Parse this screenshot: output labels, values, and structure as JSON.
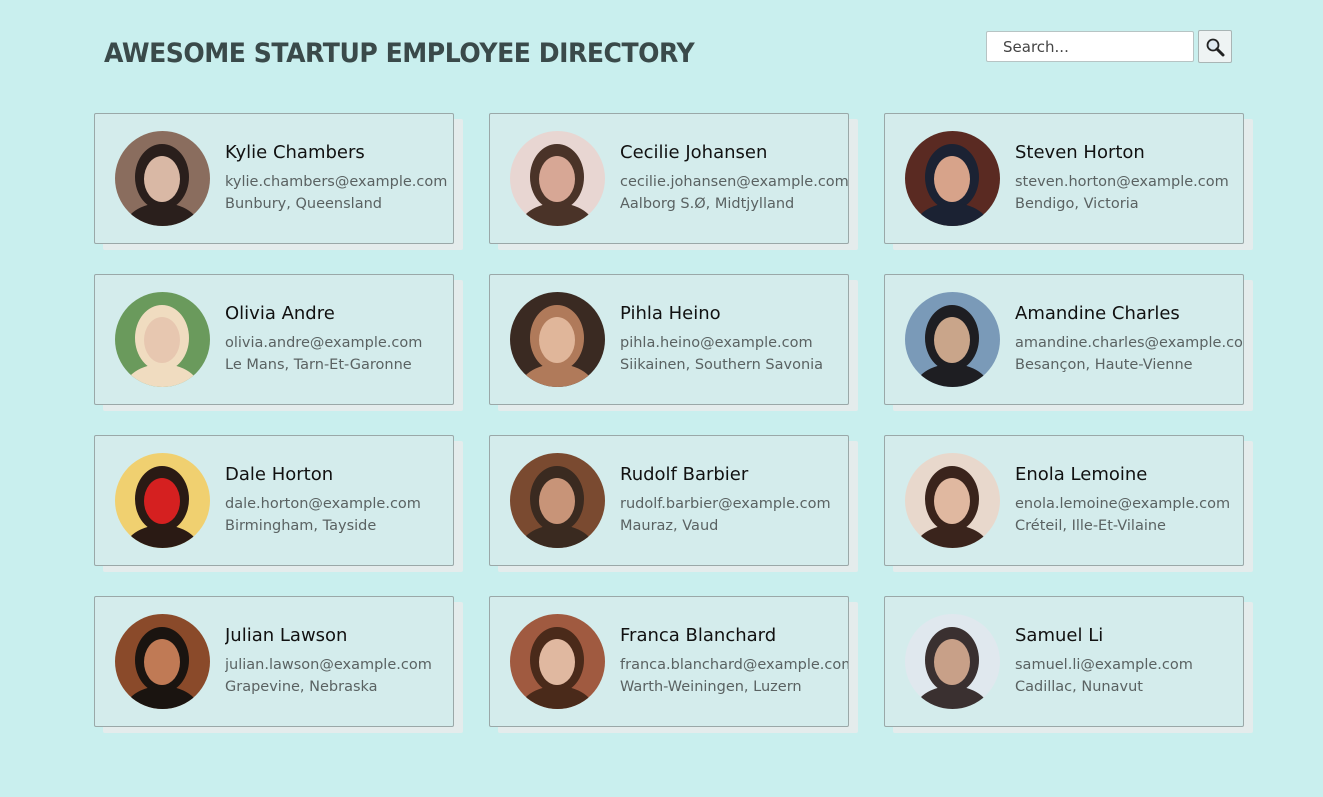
{
  "header": {
    "title": "AWESOME STARTUP EMPLOYEE DIRECTORY"
  },
  "search": {
    "placeholder": "Search...",
    "button_icon": "magnifier-icon"
  },
  "employees": [
    {
      "name": "Kylie Chambers",
      "email": "kylie.chambers@example.com",
      "location": "Bunbury, Queensland",
      "avatar_colors": [
        "#8a6d5e",
        "#2a1f1c",
        "#d9b8a5"
      ]
    },
    {
      "name": "Cecilie Johansen",
      "email": "cecilie.johansen@example.com",
      "location": "Aalborg S.Ø, Midtjylland",
      "avatar_colors": [
        "#e8d6d2",
        "#4a3328",
        "#d7a795"
      ]
    },
    {
      "name": "Steven Horton",
      "email": "steven.horton@example.com",
      "location": "Bendigo, Victoria",
      "avatar_colors": [
        "#5a2a22",
        "#1b2233",
        "#d7a38a"
      ]
    },
    {
      "name": "Olivia Andre",
      "email": "olivia.andre@example.com",
      "location": "Le Mans, Tarn-Et-Garonne",
      "avatar_colors": [
        "#6a9a5c",
        "#f0dcc0",
        "#e7c7b0"
      ]
    },
    {
      "name": "Pihla Heino",
      "email": "pihla.heino@example.com",
      "location": "Siikainen, Southern Savonia",
      "avatar_colors": [
        "#3a2a22",
        "#b07a5a",
        "#e0b69a"
      ]
    },
    {
      "name": "Amandine Charles",
      "email": "amandine.charles@example.com",
      "location": "Besançon, Haute-Vienne",
      "avatar_colors": [
        "#7a9ab8",
        "#1e1e22",
        "#c9a58a"
      ]
    },
    {
      "name": "Dale Horton",
      "email": "dale.horton@example.com",
      "location": "Birmingham, Tayside",
      "avatar_colors": [
        "#f0d070",
        "#2a1a14",
        "#d52020"
      ]
    },
    {
      "name": "Rudolf Barbier",
      "email": "rudolf.barbier@example.com",
      "location": "Mauraz, Vaud",
      "avatar_colors": [
        "#7a4a30",
        "#3a2a20",
        "#c89478"
      ]
    },
    {
      "name": "Enola Lemoine",
      "email": "enola.lemoine@example.com",
      "location": "Créteil, Ille-Et-Vilaine",
      "avatar_colors": [
        "#e8d8cc",
        "#3a241c",
        "#e0b8a0"
      ]
    },
    {
      "name": "Julian Lawson",
      "email": "julian.lawson@example.com",
      "location": "Grapevine, Nebraska",
      "avatar_colors": [
        "#8a4a2a",
        "#1a1410",
        "#c07a55"
      ]
    },
    {
      "name": "Franca Blanchard",
      "email": "franca.blanchard@example.com",
      "location": "Warth-Weiningen, Luzern",
      "avatar_colors": [
        "#a05a40",
        "#4a2a1a",
        "#e0b8a0"
      ]
    },
    {
      "name": "Samuel Li",
      "email": "samuel.li@example.com",
      "location": "Cadillac, Nunavut",
      "avatar_colors": [
        "#e0e8ee",
        "#3a3030",
        "#c8a088"
      ]
    }
  ]
}
